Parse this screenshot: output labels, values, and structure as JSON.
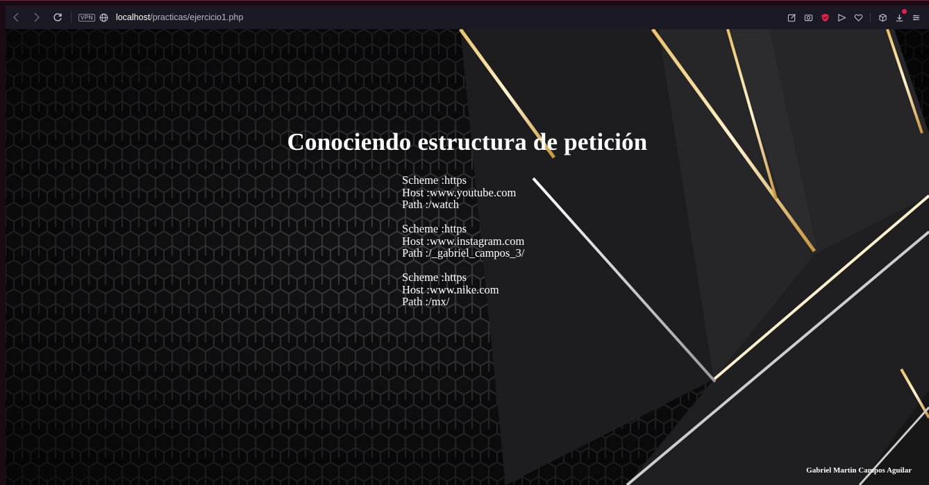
{
  "browser": {
    "vpn_label": "VPN",
    "url_host": "localhost",
    "url_path": "/practicas/ejercicio1.php",
    "accent_color": "#e91e4a",
    "icons": [
      "back-icon",
      "forward-icon",
      "reload-icon",
      "vpn-badge",
      "globe-icon",
      "edit-icon",
      "camera-icon",
      "shield-icon",
      "send-icon",
      "heart-icon",
      "box-icon",
      "download-icon",
      "menu-icon"
    ]
  },
  "page": {
    "title": "Conociendo estructura de petición",
    "requests": [
      {
        "scheme": "Scheme :https",
        "host": "Host :www.youtube.com",
        "path": "Path :/watch"
      },
      {
        "scheme": "Scheme :https",
        "host": "Host :www.instagram.com",
        "path": "Path :/_gabriel_campos_3/"
      },
      {
        "scheme": "Scheme :https",
        "host": "Host :www.nike.com",
        "path": "Path :/mx/"
      }
    ],
    "author": "Gabriel Martin Campos Aguilar"
  }
}
